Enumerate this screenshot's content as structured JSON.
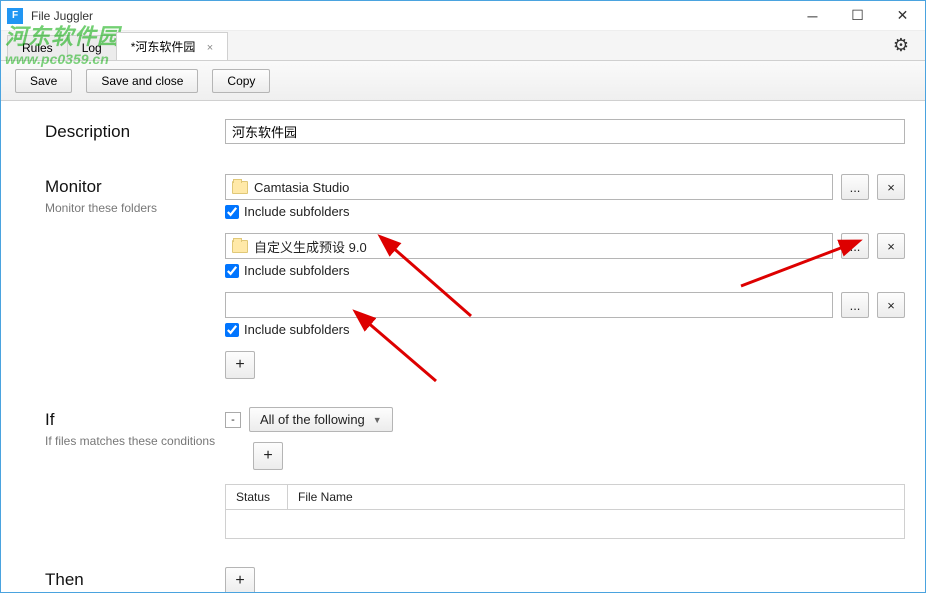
{
  "window": {
    "title": "File Juggler",
    "icon_letter": "F"
  },
  "tabs": {
    "items": [
      {
        "label": "Rules",
        "active": false
      },
      {
        "label": "Log",
        "active": false
      },
      {
        "label": "*河东软件园",
        "active": true
      }
    ]
  },
  "toolbar": {
    "save": "Save",
    "save_close": "Save and close",
    "copy": "Copy"
  },
  "sections": {
    "description": {
      "heading": "Description",
      "value": "河东软件园"
    },
    "monitor": {
      "heading": "Monitor",
      "sub": "Monitor these folders",
      "include_label": "Include subfolders",
      "browse": "...",
      "remove": "×",
      "add": "+",
      "folders": [
        {
          "path": "Camtasia Studio",
          "has_icon": true,
          "include": true
        },
        {
          "path": "自定义生成预设 9.0",
          "has_icon": true,
          "include": true
        },
        {
          "path": "",
          "has_icon": false,
          "include": true
        }
      ]
    },
    "if": {
      "heading": "If",
      "sub": "If files matches these conditions",
      "collapse": "-",
      "mode": "All of the following",
      "add": "+",
      "columns": {
        "status": "Status",
        "filename": "File Name"
      }
    },
    "then": {
      "heading": "Then",
      "add": "+"
    }
  },
  "watermark": {
    "line1": "河东软件园",
    "line2": "www.pc0359.cn"
  }
}
